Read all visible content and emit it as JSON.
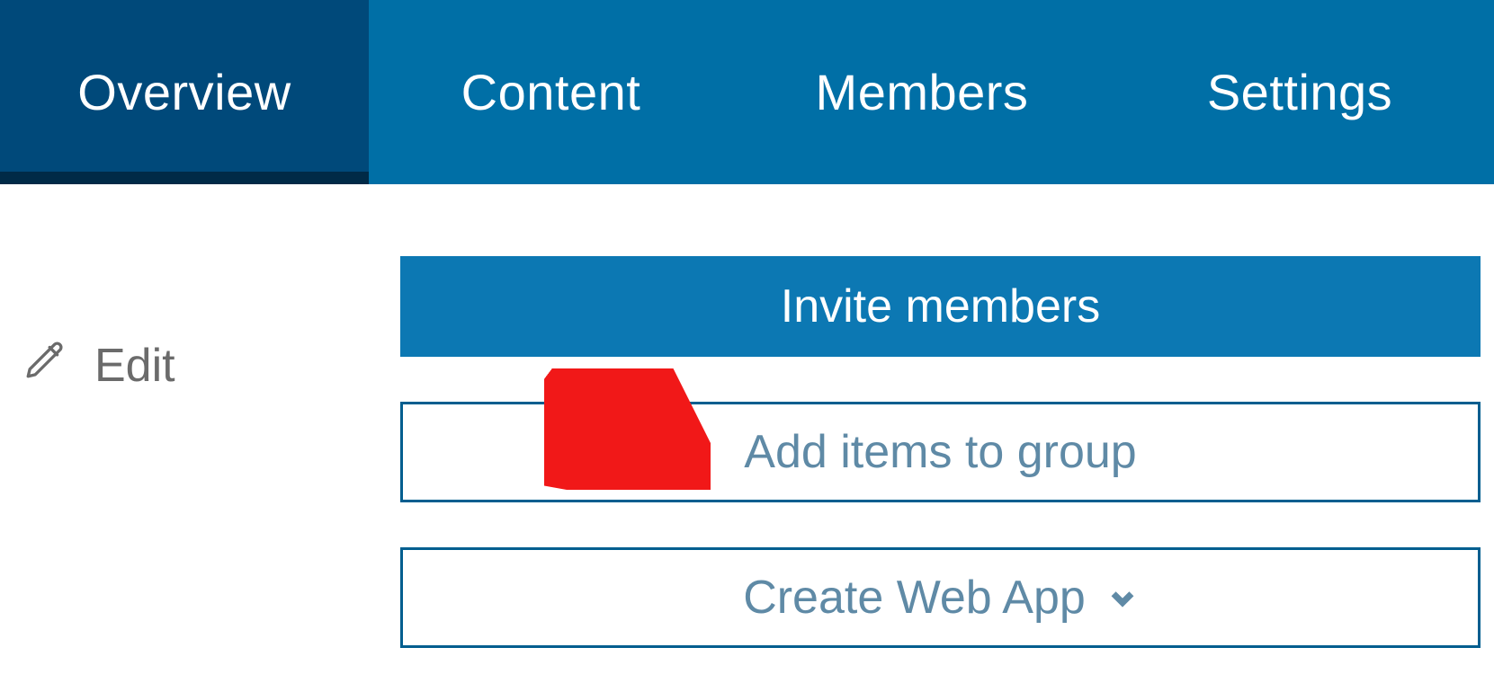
{
  "nav": {
    "tabs": [
      {
        "label": "Overview",
        "active": true
      },
      {
        "label": "Content",
        "active": false
      },
      {
        "label": "Members",
        "active": false
      },
      {
        "label": "Settings",
        "active": false
      }
    ]
  },
  "sidebar": {
    "edit_label": "Edit"
  },
  "actions": {
    "invite_members_label": "Invite members",
    "add_items_label": "Add items to group",
    "create_web_app_label": "Create Web App"
  },
  "annotation": {
    "arrow_color": "#f11818",
    "target": "add-items-to-group-button"
  }
}
